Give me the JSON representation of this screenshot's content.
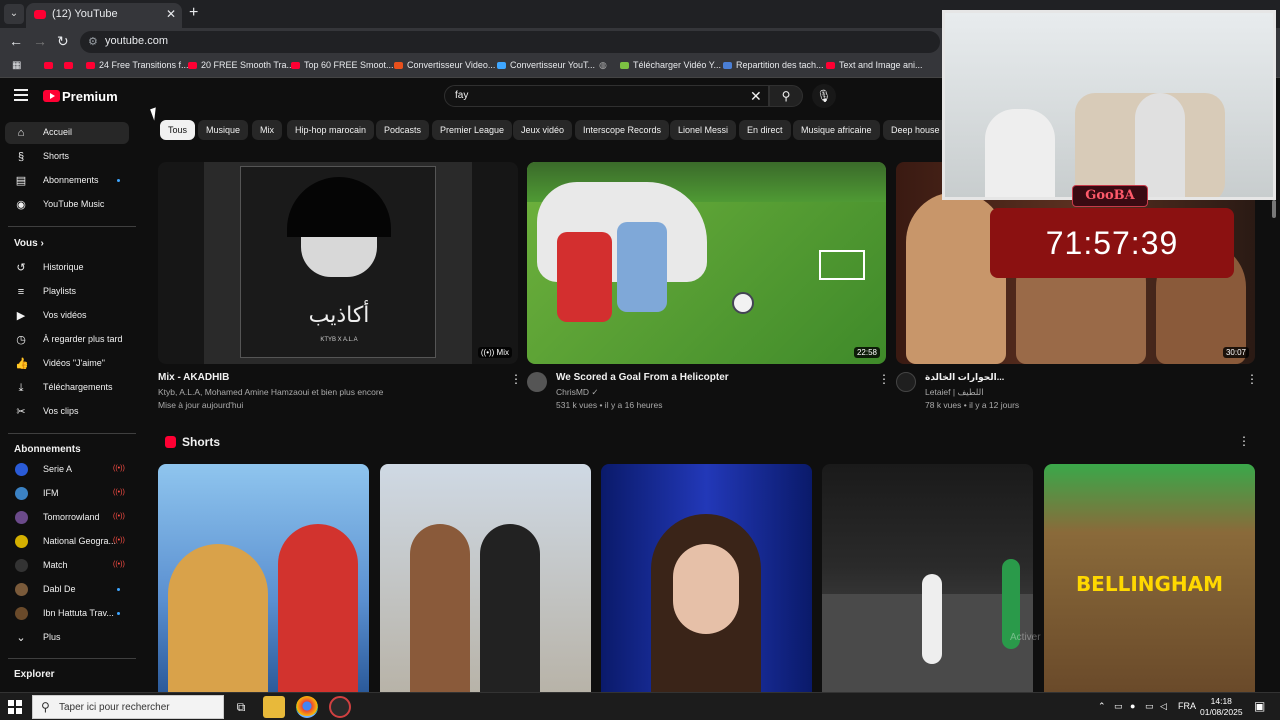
{
  "browser": {
    "tab_title": "(12) YouTube",
    "url": "youtube.com",
    "bookmarks": [
      "24 Free Transitions f...",
      "20 FREE Smooth Tra...",
      "Top 60 FREE Smoot...",
      "Convertisseur Video...",
      "Convertisseur YouT...",
      "Télécharger Vidéo Y...",
      "Repartition des tach...",
      "Text and Image ani..."
    ]
  },
  "header": {
    "brand": "Premium",
    "search_value": "fay"
  },
  "sidebar": {
    "main": [
      {
        "label": "Accueil",
        "icon": "home-icon"
      },
      {
        "label": "Shorts",
        "icon": "shorts-icon"
      },
      {
        "label": "Abonnements",
        "icon": "subscriptions-icon"
      },
      {
        "label": "YouTube Music",
        "icon": "music-icon"
      }
    ],
    "you_title": "Vous",
    "you": [
      {
        "label": "Historique",
        "icon": "history-icon"
      },
      {
        "label": "Playlists",
        "icon": "playlist-icon"
      },
      {
        "label": "Vos vidéos",
        "icon": "video-icon"
      },
      {
        "label": "À regarder plus tard",
        "icon": "clock-icon"
      },
      {
        "label": "Vidéos \"J'aime\"",
        "icon": "like-icon"
      },
      {
        "label": "Téléchargements",
        "icon": "download-icon"
      },
      {
        "label": "Vos clips",
        "icon": "scissors-icon"
      }
    ],
    "subs_title": "Abonnements",
    "subs": [
      {
        "label": "Serie A",
        "color": "#2a5bd7"
      },
      {
        "label": "IFM",
        "color": "#3b82c4"
      },
      {
        "label": "Tomorrowland",
        "color": "#6b4a8a"
      },
      {
        "label": "National Geogra...",
        "color": "#d4b000"
      },
      {
        "label": "Match",
        "color": "#222"
      },
      {
        "label": "Dabl De",
        "color": "#7a5a3a"
      },
      {
        "label": "Ibn Hattuta Trav...",
        "color": "#6a4a2a"
      },
      {
        "label": "Plus",
        "color": ""
      }
    ],
    "explore_title": "Explorer"
  },
  "chips": [
    "Tous",
    "Musique",
    "Mix",
    "Hip-hop marocain",
    "Podcasts",
    "Premier League",
    "Jeux vidéo",
    "Interscope Records",
    "Lionel Messi",
    "En direct",
    "Musique africaine",
    "Deep house"
  ],
  "videos": [
    {
      "title": "Mix - AKADHIB",
      "line1": "Ktyb, A.L.A, Mohamed Amine Hamzaoui et bien plus encore",
      "line2": "Mise à jour aujourd'hui",
      "badge": "Mix",
      "cover_title": "أكاذيب",
      "cover_sub": "KTYB X A.L.A"
    },
    {
      "title": "We Scored a Goal From a Helicopter",
      "line1": "ChrisMD ✓",
      "line2": "531 k vues • il y a 16 heures",
      "duration": "22:58"
    },
    {
      "title": "الحوارات الخالدة...",
      "line1": "Letaief | اللطيف",
      "line2": "78 k vues • il y a 12 jours",
      "duration": "30:07"
    }
  ],
  "shorts": {
    "title": "Shorts",
    "overlay_text": "BELLINGHAM"
  },
  "overlay": {
    "timer": "71:57:39",
    "logo": "GooBA"
  },
  "taskbar": {
    "search_placeholder": "Taper ici pour rechercher",
    "lang": "FRA",
    "time": "14:18",
    "date": "01/08/2025"
  }
}
